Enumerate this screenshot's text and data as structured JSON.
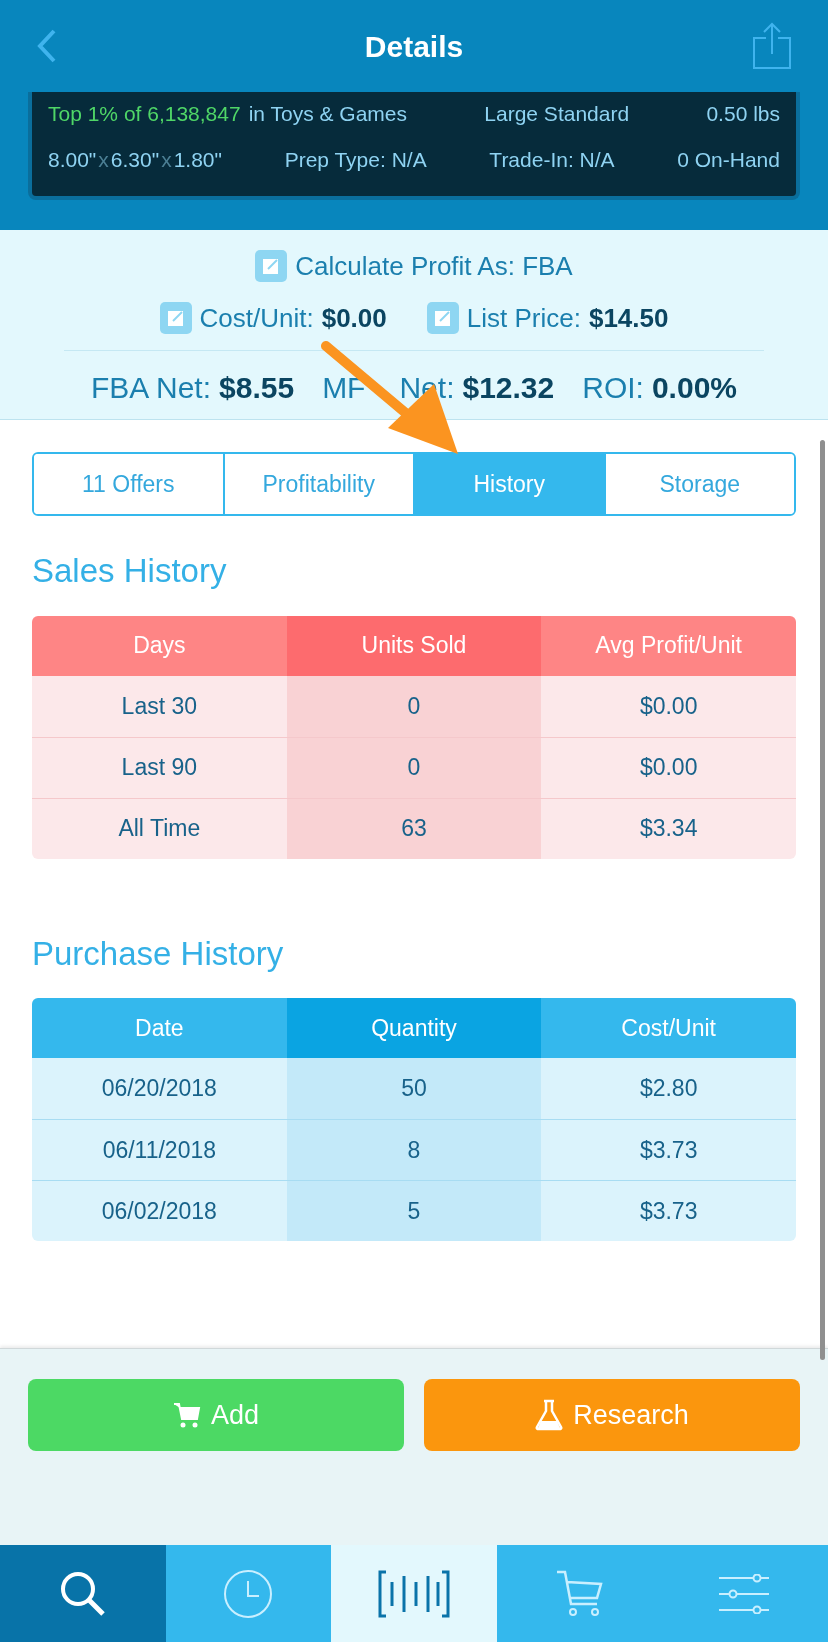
{
  "header": {
    "title": "Details"
  },
  "info": {
    "rank_highlight": "Top 1% of 6,138,847",
    "rank_rest": "in Toys & Games",
    "size_tier": "Large Standard",
    "weight": "0.50 lbs",
    "dims": [
      {
        "kind": "value",
        "text": "8.00\""
      },
      {
        "kind": "sep",
        "text": "x"
      },
      {
        "kind": "value",
        "text": "6.30\""
      },
      {
        "kind": "sep",
        "text": "x"
      },
      {
        "kind": "value",
        "text": "1.80\""
      }
    ],
    "prep": "Prep Type: N/A",
    "trade_in": "Trade-In: N/A",
    "on_hand": "0 On-Hand"
  },
  "profit": {
    "calc": {
      "label": "Calculate Profit As: FBA"
    },
    "cost": {
      "label": "Cost/Unit:",
      "value": "$0.00"
    },
    "list_price": {
      "label": "List Price:",
      "value": "$14.50"
    },
    "totals": [
      {
        "label": "FBA Net:",
        "value": "$8.55"
      },
      {
        "label": "MF",
        "label_after_arrow": "Net:",
        "value": "$12.32"
      },
      {
        "label": "ROI:",
        "value": "0.00%"
      }
    ]
  },
  "tabs": [
    {
      "label": "11 Offers",
      "selected": false
    },
    {
      "label": "Profitability",
      "selected": false
    },
    {
      "label": "History",
      "selected": true
    },
    {
      "label": "Storage",
      "selected": false
    }
  ],
  "sales_history": {
    "title": "Sales History",
    "columns": [
      "Days",
      "Units Sold",
      "Avg Profit/Unit"
    ],
    "rows": [
      [
        "Last 30",
        "0",
        "$0.00"
      ],
      [
        "Last 90",
        "0",
        "$0.00"
      ],
      [
        "All Time",
        "63",
        "$3.34"
      ]
    ]
  },
  "purchase_history": {
    "title": "Purchase History",
    "columns": [
      "Date",
      "Quantity",
      "Cost/Unit"
    ],
    "rows": [
      [
        "06/20/2018",
        "50",
        "$2.80"
      ],
      [
        "06/11/2018",
        "8",
        "$3.73"
      ],
      [
        "06/02/2018",
        "5",
        "$3.73"
      ]
    ]
  },
  "actions": [
    {
      "kind": "add",
      "label": "Add"
    },
    {
      "kind": "research",
      "label": "Research"
    }
  ],
  "nav": [
    {
      "kind": "search",
      "selected": true
    },
    {
      "kind": "history",
      "selected": false
    },
    {
      "kind": "scan",
      "selected": false
    },
    {
      "kind": "cart",
      "selected": false
    },
    {
      "kind": "settings",
      "selected": false
    }
  ]
}
